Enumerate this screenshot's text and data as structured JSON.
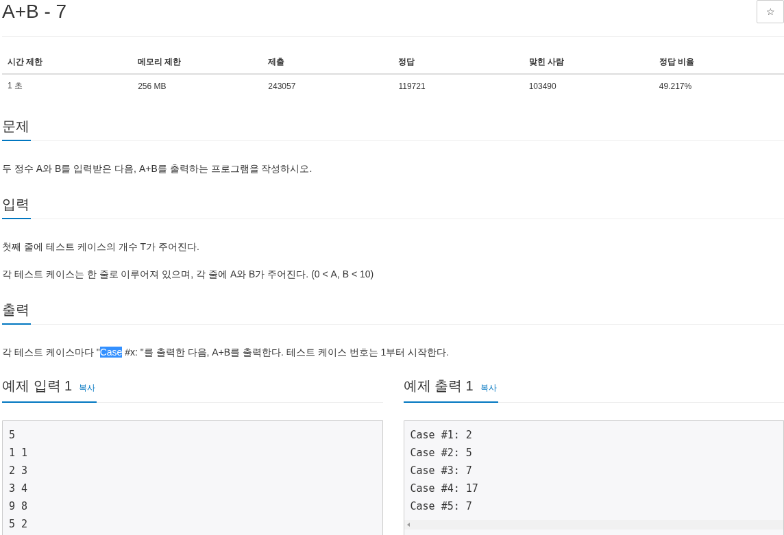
{
  "title": "A+B - 7",
  "star_button": {
    "label": "☆"
  },
  "info_table": {
    "columns": [
      "시간 제한",
      "메모리 제한",
      "제출",
      "정답",
      "맞힌 사람",
      "정답 비율"
    ],
    "rows": [
      [
        "1 초",
        "256 MB",
        "243057",
        "119721",
        "103490",
        "49.217%"
      ]
    ]
  },
  "sections": [
    {
      "heading": "문제",
      "paragraphs": [
        [
          {
            "text": "두 정수 A와 B를 입력받은 다음, A+B를 출력하는 프로그램을 작성하시오.",
            "selected": false
          }
        ]
      ]
    },
    {
      "heading": "입력",
      "paragraphs": [
        [
          {
            "text": "첫째 줄에 테스트 케이스의 개수 T가 주어진다.",
            "selected": false
          }
        ],
        [
          {
            "text": "각 테스트 케이스는 한 줄로 이루어져 있으며, 각 줄에 A와 B가 주어진다. (0 < A, B < 10)",
            "selected": false
          }
        ]
      ]
    },
    {
      "heading": "출력",
      "paragraphs": [
        [
          {
            "text": "각 테스트 케이스마다 \"",
            "selected": false
          },
          {
            "text": "Case",
            "selected": true
          },
          {
            "text": " #x: \"를 출력한 다음, A+B를 출력한다. 테스트 케이스 번호는 1부터 시작한다.",
            "selected": false
          }
        ]
      ]
    }
  ],
  "samples": [
    {
      "heading": "예제 입력 1",
      "copy_link": "복사",
      "lines": [
        "5",
        "1 1",
        "2 3",
        "3 4",
        "9 8",
        "5 2"
      ],
      "scrollbar": false
    },
    {
      "heading": "예제 출력 1",
      "copy_link": "복사",
      "lines": [
        "Case #1: 2",
        "Case #2: 5",
        "Case #3: 7",
        "Case #4: 17",
        "Case #5: 7"
      ],
      "scrollbar": true
    }
  ]
}
